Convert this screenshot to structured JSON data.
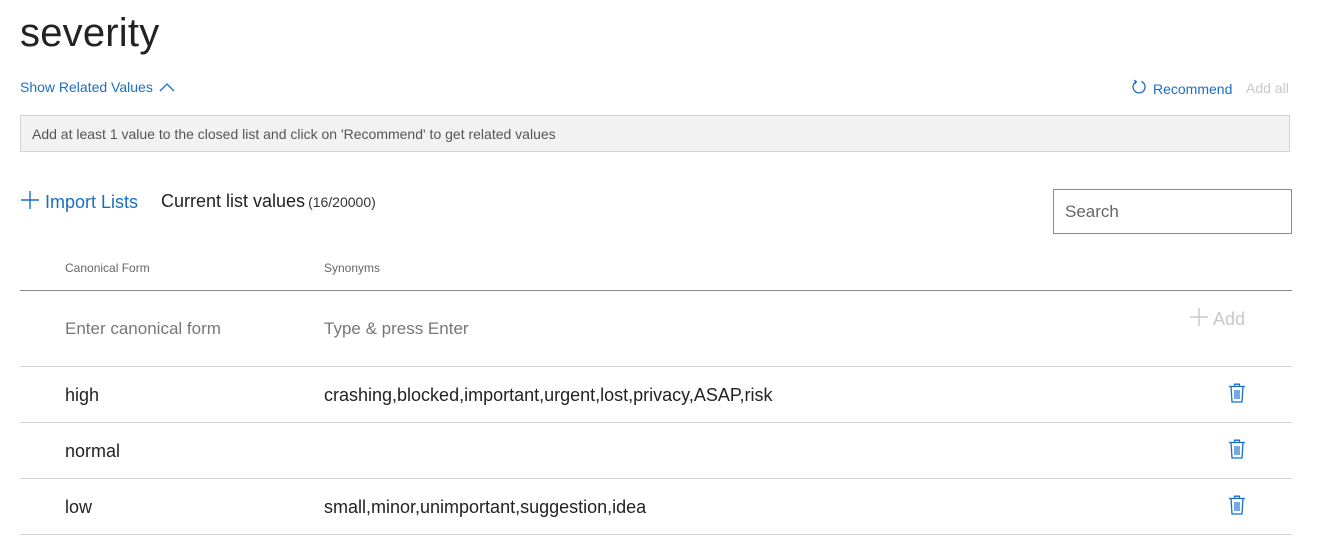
{
  "entity": {
    "title": "severity"
  },
  "related": {
    "toggle_label": "Show Related Values",
    "recommend_label": "Recommend",
    "add_all_label": "Add all",
    "info_message": "Add at least 1 value to the closed list and click on 'Recommend' to get related values"
  },
  "list": {
    "import_label": "Import Lists",
    "current_label": "Current list values",
    "count": "(16/20000)",
    "search_placeholder": "Search",
    "columns": {
      "canonical": "Canonical Form",
      "synonyms": "Synonyms"
    },
    "new_entry": {
      "canonical_placeholder": "Enter canonical form",
      "synonyms_placeholder": "Type & press Enter",
      "add_label": "Add"
    },
    "rows": [
      {
        "canonical": "high",
        "synonyms": "crashing,blocked,important,urgent,lost,privacy,ASAP,risk"
      },
      {
        "canonical": "normal",
        "synonyms": ""
      },
      {
        "canonical": "low",
        "synonyms": "small,minor,unimportant,suggestion,idea"
      }
    ]
  },
  "colors": {
    "accent": "#1a6fc4",
    "disabled": "#c8c8c8",
    "info_bg": "#f2f2f2"
  },
  "icons": {
    "chevron": "chevron-up-icon",
    "recommend": "refresh-icon",
    "import": "plus-icon",
    "add": "plus-icon",
    "delete": "trash-icon"
  }
}
